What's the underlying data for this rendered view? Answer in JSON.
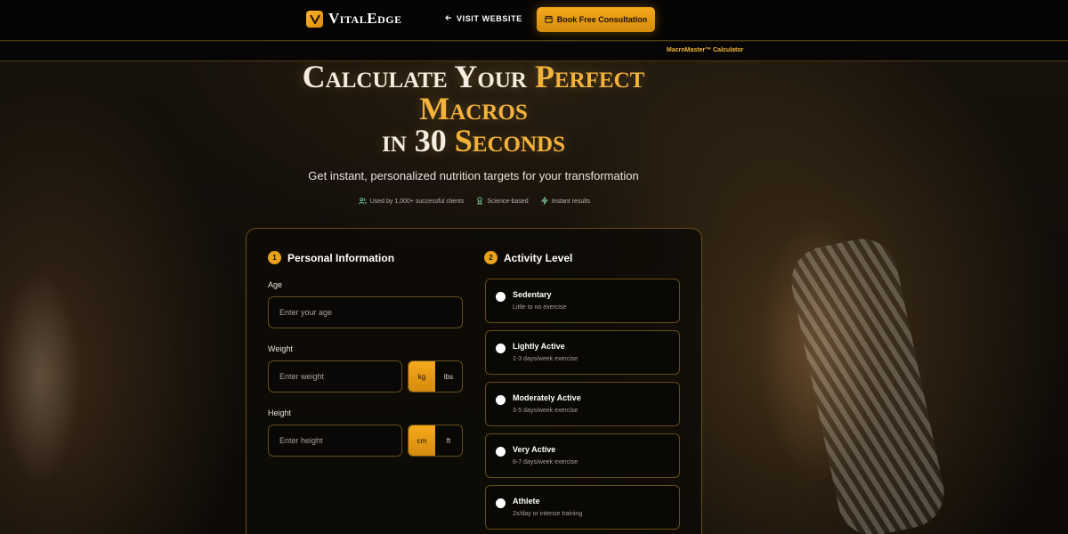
{
  "header": {
    "brand": "VitalEdge",
    "visit_label": "VISIT WEBSITE",
    "book_label": "Book Free Consultation"
  },
  "subbar": {
    "label": "MacroMaster™ Calculator"
  },
  "hero": {
    "title_line1_white": "Calculate Your",
    "title_line1_gold": "Perfect",
    "title_line2_gold": "Macros",
    "title_line3_white": "in 30",
    "title_line3_gold": "Seconds",
    "subtitle": "Get instant, personalized nutrition targets for your transformation",
    "badges": [
      {
        "icon": "users-icon",
        "label": "Used by 1,000+ successful clients"
      },
      {
        "icon": "award-icon",
        "label": "Science-based"
      },
      {
        "icon": "bolt-icon",
        "label": "Instant results"
      }
    ]
  },
  "personal": {
    "step": "1",
    "title": "Personal Information",
    "age_label": "Age",
    "age_placeholder": "Enter your age",
    "weight_label": "Weight",
    "weight_placeholder": "Enter weight",
    "weight_units": [
      "kg",
      "lbs"
    ],
    "weight_unit_selected": "kg",
    "height_label": "Height",
    "height_placeholder": "Enter height",
    "height_units": [
      "cm",
      "ft"
    ],
    "height_unit_selected": "cm"
  },
  "activity": {
    "step": "2",
    "title": "Activity Level",
    "options": [
      {
        "title": "Sedentary",
        "desc": "Little to no exercise"
      },
      {
        "title": "Lightly Active",
        "desc": "1-3 days/week exercise"
      },
      {
        "title": "Moderately Active",
        "desc": "3-5 days/week exercise"
      },
      {
        "title": "Very Active",
        "desc": "6-7 days/week exercise"
      },
      {
        "title": "Athlete",
        "desc": "2x/day or intense training"
      }
    ]
  },
  "colors": {
    "accent": "#f3b33a",
    "button": "#e9a21c",
    "border": "#d4a028",
    "background": "#0b0906"
  }
}
